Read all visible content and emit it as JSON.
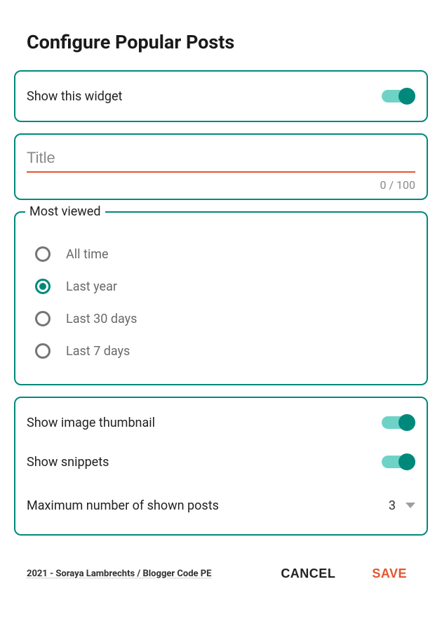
{
  "dialog": {
    "title": "Configure Popular Posts"
  },
  "showWidget": {
    "label": "Show this widget",
    "enabled": true
  },
  "titleField": {
    "placeholder": "Title",
    "value": "",
    "counter": "0 / 100"
  },
  "mostViewed": {
    "legend": "Most viewed",
    "options": [
      {
        "label": "All time",
        "checked": false
      },
      {
        "label": "Last year",
        "checked": true
      },
      {
        "label": "Last 30 days",
        "checked": false
      },
      {
        "label": "Last 7 days",
        "checked": false
      }
    ]
  },
  "display": {
    "thumbnail": {
      "label": "Show image thumbnail",
      "enabled": true
    },
    "snippets": {
      "label": "Show snippets",
      "enabled": true
    },
    "maxPosts": {
      "label": "Maximum number of shown posts",
      "value": "3"
    }
  },
  "footer": {
    "credits": "2021 - Soraya Lambrechts / Blogger Code PE",
    "cancel": "CANCEL",
    "save": "SAVE"
  }
}
